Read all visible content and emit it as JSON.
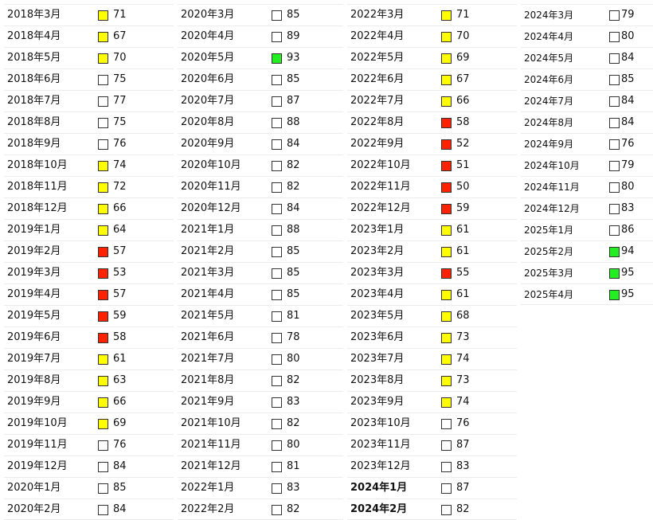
{
  "colors": {
    "white": "#ffffff",
    "yellow": "#ffff00",
    "red": "#ff2200",
    "green": "#22ee22"
  },
  "columns": [
    {
      "rows": [
        {
          "date": "2018年3月",
          "value": "71",
          "color": "yellow"
        },
        {
          "date": "2018年4月",
          "value": "67",
          "color": "yellow"
        },
        {
          "date": "2018年5月",
          "value": "70",
          "color": "yellow"
        },
        {
          "date": "2018年6月",
          "value": "75",
          "color": "white"
        },
        {
          "date": "2018年7月",
          "value": "77",
          "color": "white"
        },
        {
          "date": "2018年8月",
          "value": "75",
          "color": "white"
        },
        {
          "date": "2018年9月",
          "value": "76",
          "color": "white"
        },
        {
          "date": "2018年10月",
          "value": "74",
          "color": "yellow"
        },
        {
          "date": "2018年11月",
          "value": "72",
          "color": "yellow"
        },
        {
          "date": "2018年12月",
          "value": "66",
          "color": "yellow"
        },
        {
          "date": "2019年1月",
          "value": "64",
          "color": "yellow"
        },
        {
          "date": "2019年2月",
          "value": "57",
          "color": "red"
        },
        {
          "date": "2019年3月",
          "value": "53",
          "color": "red"
        },
        {
          "date": "2019年4月",
          "value": "57",
          "color": "red"
        },
        {
          "date": "2019年5月",
          "value": "59",
          "color": "red"
        },
        {
          "date": "2019年6月",
          "value": "58",
          "color": "red"
        },
        {
          "date": "2019年7月",
          "value": "61",
          "color": "yellow"
        },
        {
          "date": "2019年8月",
          "value": "63",
          "color": "yellow"
        },
        {
          "date": "2019年9月",
          "value": "66",
          "color": "yellow"
        },
        {
          "date": "2019年10月",
          "value": "69",
          "color": "yellow"
        },
        {
          "date": "2019年11月",
          "value": "76",
          "color": "white"
        },
        {
          "date": "2019年12月",
          "value": "84",
          "color": "white"
        },
        {
          "date": "2020年1月",
          "value": "85",
          "color": "white"
        },
        {
          "date": "2020年2月",
          "value": "84",
          "color": "white"
        }
      ]
    },
    {
      "rows": [
        {
          "date": "2020年3月",
          "value": "85",
          "color": "white"
        },
        {
          "date": "2020年4月",
          "value": "89",
          "color": "white"
        },
        {
          "date": "2020年5月",
          "value": "93",
          "color": "green"
        },
        {
          "date": "2020年6月",
          "value": "85",
          "color": "white"
        },
        {
          "date": "2020年7月",
          "value": "87",
          "color": "white"
        },
        {
          "date": "2020年8月",
          "value": "88",
          "color": "white"
        },
        {
          "date": "2020年9月",
          "value": "84",
          "color": "white"
        },
        {
          "date": "2020年10月",
          "value": "82",
          "color": "white"
        },
        {
          "date": "2020年11月",
          "value": "82",
          "color": "white"
        },
        {
          "date": "2020年12月",
          "value": "84",
          "color": "white"
        },
        {
          "date": "2021年1月",
          "value": "88",
          "color": "white"
        },
        {
          "date": "2021年2月",
          "value": "85",
          "color": "white"
        },
        {
          "date": "2021年3月",
          "value": "85",
          "color": "white"
        },
        {
          "date": "2021年4月",
          "value": "85",
          "color": "white"
        },
        {
          "date": "2021年5月",
          "value": "81",
          "color": "white"
        },
        {
          "date": "2021年6月",
          "value": "78",
          "color": "white"
        },
        {
          "date": "2021年7月",
          "value": "80",
          "color": "white"
        },
        {
          "date": "2021年8月",
          "value": "82",
          "color": "white"
        },
        {
          "date": "2021年9月",
          "value": "83",
          "color": "white"
        },
        {
          "date": "2021年10月",
          "value": "82",
          "color": "white"
        },
        {
          "date": "2021年11月",
          "value": "80",
          "color": "white"
        },
        {
          "date": "2021年12月",
          "value": "81",
          "color": "white"
        },
        {
          "date": "2022年1月",
          "value": "83",
          "color": "white"
        },
        {
          "date": "2022年2月",
          "value": "82",
          "color": "white"
        }
      ]
    },
    {
      "rows": [
        {
          "date": "2022年3月",
          "value": "71",
          "color": "yellow"
        },
        {
          "date": "2022年4月",
          "value": "70",
          "color": "yellow"
        },
        {
          "date": "2022年5月",
          "value": "69",
          "color": "yellow"
        },
        {
          "date": "2022年6月",
          "value": "67",
          "color": "yellow"
        },
        {
          "date": "2022年7月",
          "value": "66",
          "color": "yellow"
        },
        {
          "date": "2022年8月",
          "value": "58",
          "color": "red"
        },
        {
          "date": "2022年9月",
          "value": "52",
          "color": "red"
        },
        {
          "date": "2022年10月",
          "value": "51",
          "color": "red"
        },
        {
          "date": "2022年11月",
          "value": "50",
          "color": "red"
        },
        {
          "date": "2022年12月",
          "value": "59",
          "color": "red"
        },
        {
          "date": "2023年1月",
          "value": "61",
          "color": "yellow"
        },
        {
          "date": "2023年2月",
          "value": "61",
          "color": "yellow"
        },
        {
          "date": "2023年3月",
          "value": "55",
          "color": "red"
        },
        {
          "date": "2023年4月",
          "value": "61",
          "color": "yellow"
        },
        {
          "date": "2023年5月",
          "value": "68",
          "color": "yellow"
        },
        {
          "date": "2023年6月",
          "value": "73",
          "color": "yellow"
        },
        {
          "date": "2023年7月",
          "value": "74",
          "color": "yellow"
        },
        {
          "date": "2023年8月",
          "value": "73",
          "color": "yellow"
        },
        {
          "date": "2023年9月",
          "value": "74",
          "color": "yellow"
        },
        {
          "date": "2023年10月",
          "value": "76",
          "color": "white"
        },
        {
          "date": "2023年11月",
          "value": "87",
          "color": "white"
        },
        {
          "date": "2023年12月",
          "value": "83",
          "color": "white"
        },
        {
          "date": "2024年1月",
          "value": "87",
          "color": "white",
          "bold": true
        },
        {
          "date": "2024年2月",
          "value": "82",
          "color": "white",
          "bold": true
        }
      ]
    },
    {
      "rows": [
        {
          "date": "2024年3月",
          "value": "79",
          "color": "white"
        },
        {
          "date": "2024年4月",
          "value": "80",
          "color": "white"
        },
        {
          "date": "2024年5月",
          "value": "84",
          "color": "white"
        },
        {
          "date": "2024年6月",
          "value": "85",
          "color": "white"
        },
        {
          "date": "2024年7月",
          "value": "84",
          "color": "white"
        },
        {
          "date": "2024年8月",
          "value": "84",
          "color": "white"
        },
        {
          "date": "2024年9月",
          "value": "76",
          "color": "white"
        },
        {
          "date": "2024年10月",
          "value": "79",
          "color": "white"
        },
        {
          "date": "2024年11月",
          "value": "80",
          "color": "white"
        },
        {
          "date": "2024年12月",
          "value": "83",
          "color": "white"
        },
        {
          "date": "2025年1月",
          "value": "86",
          "color": "white"
        },
        {
          "date": "2025年2月",
          "value": "94",
          "color": "green"
        },
        {
          "date": "2025年3月",
          "value": "95",
          "color": "green"
        },
        {
          "date": "2025年4月",
          "value": "95",
          "color": "green"
        }
      ]
    }
  ]
}
